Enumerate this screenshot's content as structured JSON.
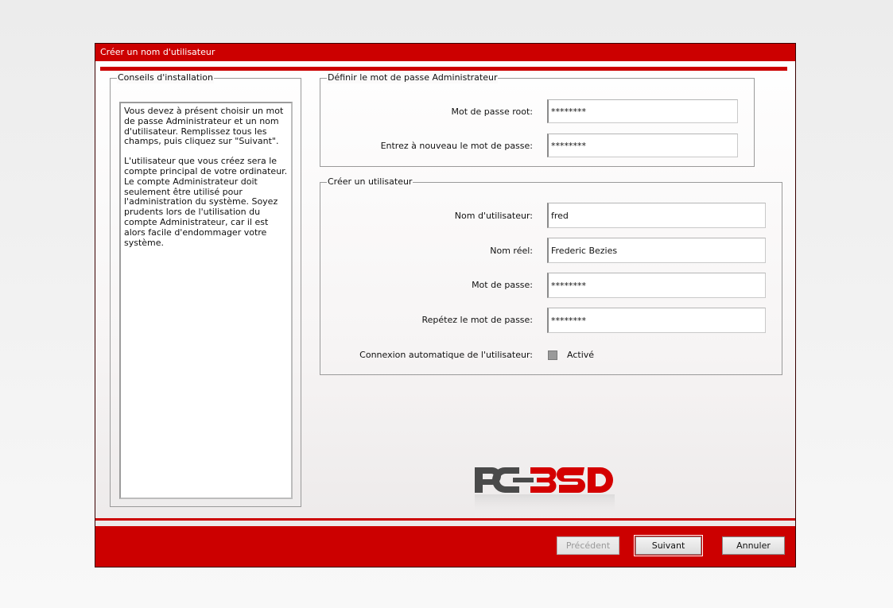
{
  "window": {
    "title": "Créer un nom d'utilisateur"
  },
  "tips": {
    "title": "Conseils d'installation",
    "paragraph1": "Vous devez à présent choisir un mot de passe Administrateur et un nom d'utilisateur. Remplissez tous les champs, puis cliquez sur \"Suivant\".",
    "paragraph2": "L'utilisateur que vous créez sera le compte principal de votre ordinateur. Le compte Administrateur doit seulement être utilisé pour l'administration du système. Soyez prudents lors de l'utilisation du compte Administrateur, car il est alors facile d'endommager votre système."
  },
  "admin": {
    "title": "Définir le mot de passe Administrateur",
    "root_label": "Mot de passe root:",
    "root_value": "********",
    "confirm_label": "Entrez à nouveau le mot de passe:",
    "confirm_value": "********"
  },
  "user": {
    "title": "Créer un utilisateur",
    "username_label": "Nom d'utilisateur:",
    "username_value": "fred",
    "realname_label": "Nom réel:",
    "realname_value": "Frederic Bezies",
    "password_label": "Mot de passe:",
    "password_value": "********",
    "repeat_label": "Repétez le mot de passe:",
    "repeat_value": "********",
    "autologin_label": "Connexion automatique de l'utilisateur:",
    "autologin_checkbox_label": "Activé",
    "autologin_checked": false
  },
  "logo": {
    "text_left": "PC",
    "text_right": "BSD"
  },
  "buttons": {
    "previous": "Précédent",
    "next": "Suivant",
    "cancel": "Annuler"
  },
  "colors": {
    "accent": "#cc0000",
    "logo_gray": "#4a4a4a",
    "logo_red": "#d40000"
  }
}
